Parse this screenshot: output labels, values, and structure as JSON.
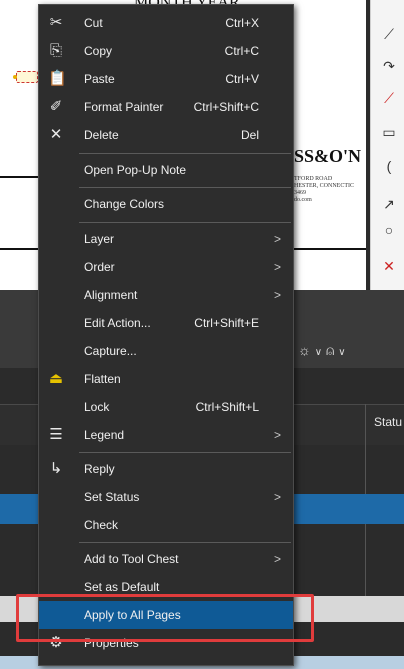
{
  "document": {
    "heading": "MONTH YEAR",
    "company": "SS&O'N",
    "address_lines": [
      "TFORD ROAD",
      "HESTER, CONNECTIC",
      "3469",
      "do.com"
    ]
  },
  "context_menu": {
    "items": [
      {
        "label": "Cut",
        "shortcut": "Ctrl+X",
        "icon": "scissors-icon"
      },
      {
        "label": "Copy",
        "shortcut": "Ctrl+C",
        "icon": "copy-icon"
      },
      {
        "label": "Paste",
        "shortcut": "Ctrl+V",
        "icon": "paste-icon"
      },
      {
        "label": "Format Painter",
        "shortcut": "Ctrl+Shift+C",
        "icon": "format-painter-icon"
      },
      {
        "label": "Delete",
        "shortcut": "Del",
        "icon": "delete-x-icon"
      },
      {
        "label": "Open Pop-Up Note"
      },
      {
        "label": "Change Colors"
      },
      {
        "label": "Layer",
        "submenu": true
      },
      {
        "label": "Order",
        "submenu": true
      },
      {
        "label": "Alignment",
        "submenu": true
      },
      {
        "label": "Edit Action...",
        "shortcut": "Ctrl+Shift+E"
      },
      {
        "label": "Capture..."
      },
      {
        "label": "Flatten",
        "icon": "flatten-icon"
      },
      {
        "label": "Lock",
        "shortcut": "Ctrl+Shift+L"
      },
      {
        "label": "Legend",
        "submenu": true,
        "icon": "legend-icon"
      },
      {
        "label": "Reply",
        "icon": "reply-arrow-icon"
      },
      {
        "label": "Set Status",
        "submenu": true
      },
      {
        "label": "Check"
      },
      {
        "label": "Add to Tool Chest",
        "submenu": true
      },
      {
        "label": "Set as Default"
      },
      {
        "label": "Apply to All Pages",
        "highlighted": true
      },
      {
        "label": "Properties",
        "icon": "gear-icon"
      }
    ]
  },
  "table": {
    "status_header": "Statu"
  },
  "colors": {
    "menu_bg": "#2d2d2d",
    "highlight": "#0f5a96",
    "callout_red": "#e03c3c",
    "selected_row": "#1e6aa8"
  }
}
